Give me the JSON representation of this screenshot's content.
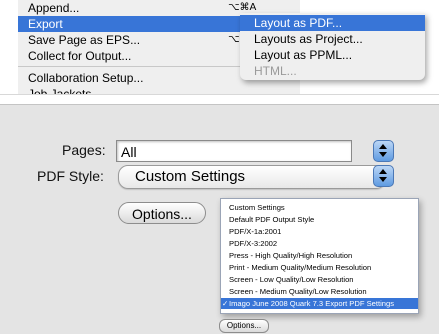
{
  "menu": {
    "items": [
      {
        "label": "Append...",
        "shortcut": "⌥⌘A"
      },
      {
        "label": "Export",
        "submenu_indicator": "▶"
      },
      {
        "label": "Save Page as EPS...",
        "shortcut": "⌥⇧⌘S"
      },
      {
        "label": "Collect for Output..."
      },
      {
        "label": "Collaboration Setup..."
      }
    ],
    "highlighted": "Export",
    "cut_off_item": "Job Jackets"
  },
  "export_submenu": {
    "items": [
      {
        "label": "Layout as PDF..."
      },
      {
        "label": "Layouts as Project..."
      },
      {
        "label": "Layout as PPML..."
      },
      {
        "label": "HTML..."
      }
    ],
    "highlighted": "Layout as PDF...",
    "disabled": "HTML..."
  },
  "dialog": {
    "pages_label": "Pages:",
    "pages_value": "All",
    "pdf_style_label": "PDF Style:",
    "pdf_style_value": "Custom Settings",
    "options_button": "Options...",
    "dropdown_options": [
      "Custom Settings",
      "Default PDF Output Style",
      "PDF/X-1a:2001",
      "PDF/X-3:2002",
      "Press - High Quality/High Resolution",
      "Print - Medium Quality/Medium Resolution",
      "Screen - Low Quality/Low Resolution",
      "Screen - Medium Quality/Low Resolution",
      "Imago June 2008 Quark 7.3 Export PDF Settings"
    ],
    "dropdown_selected": "Imago June 2008 Quark 7.3 Export PDF Settings",
    "check_mark": "✓",
    "mini_options_button": "Options..."
  },
  "colors": {
    "highlight": "#3875d7",
    "menu_background": "#efefef",
    "dialog_background": "#e4e4e4",
    "stepper_blue": "#5f9be2"
  }
}
